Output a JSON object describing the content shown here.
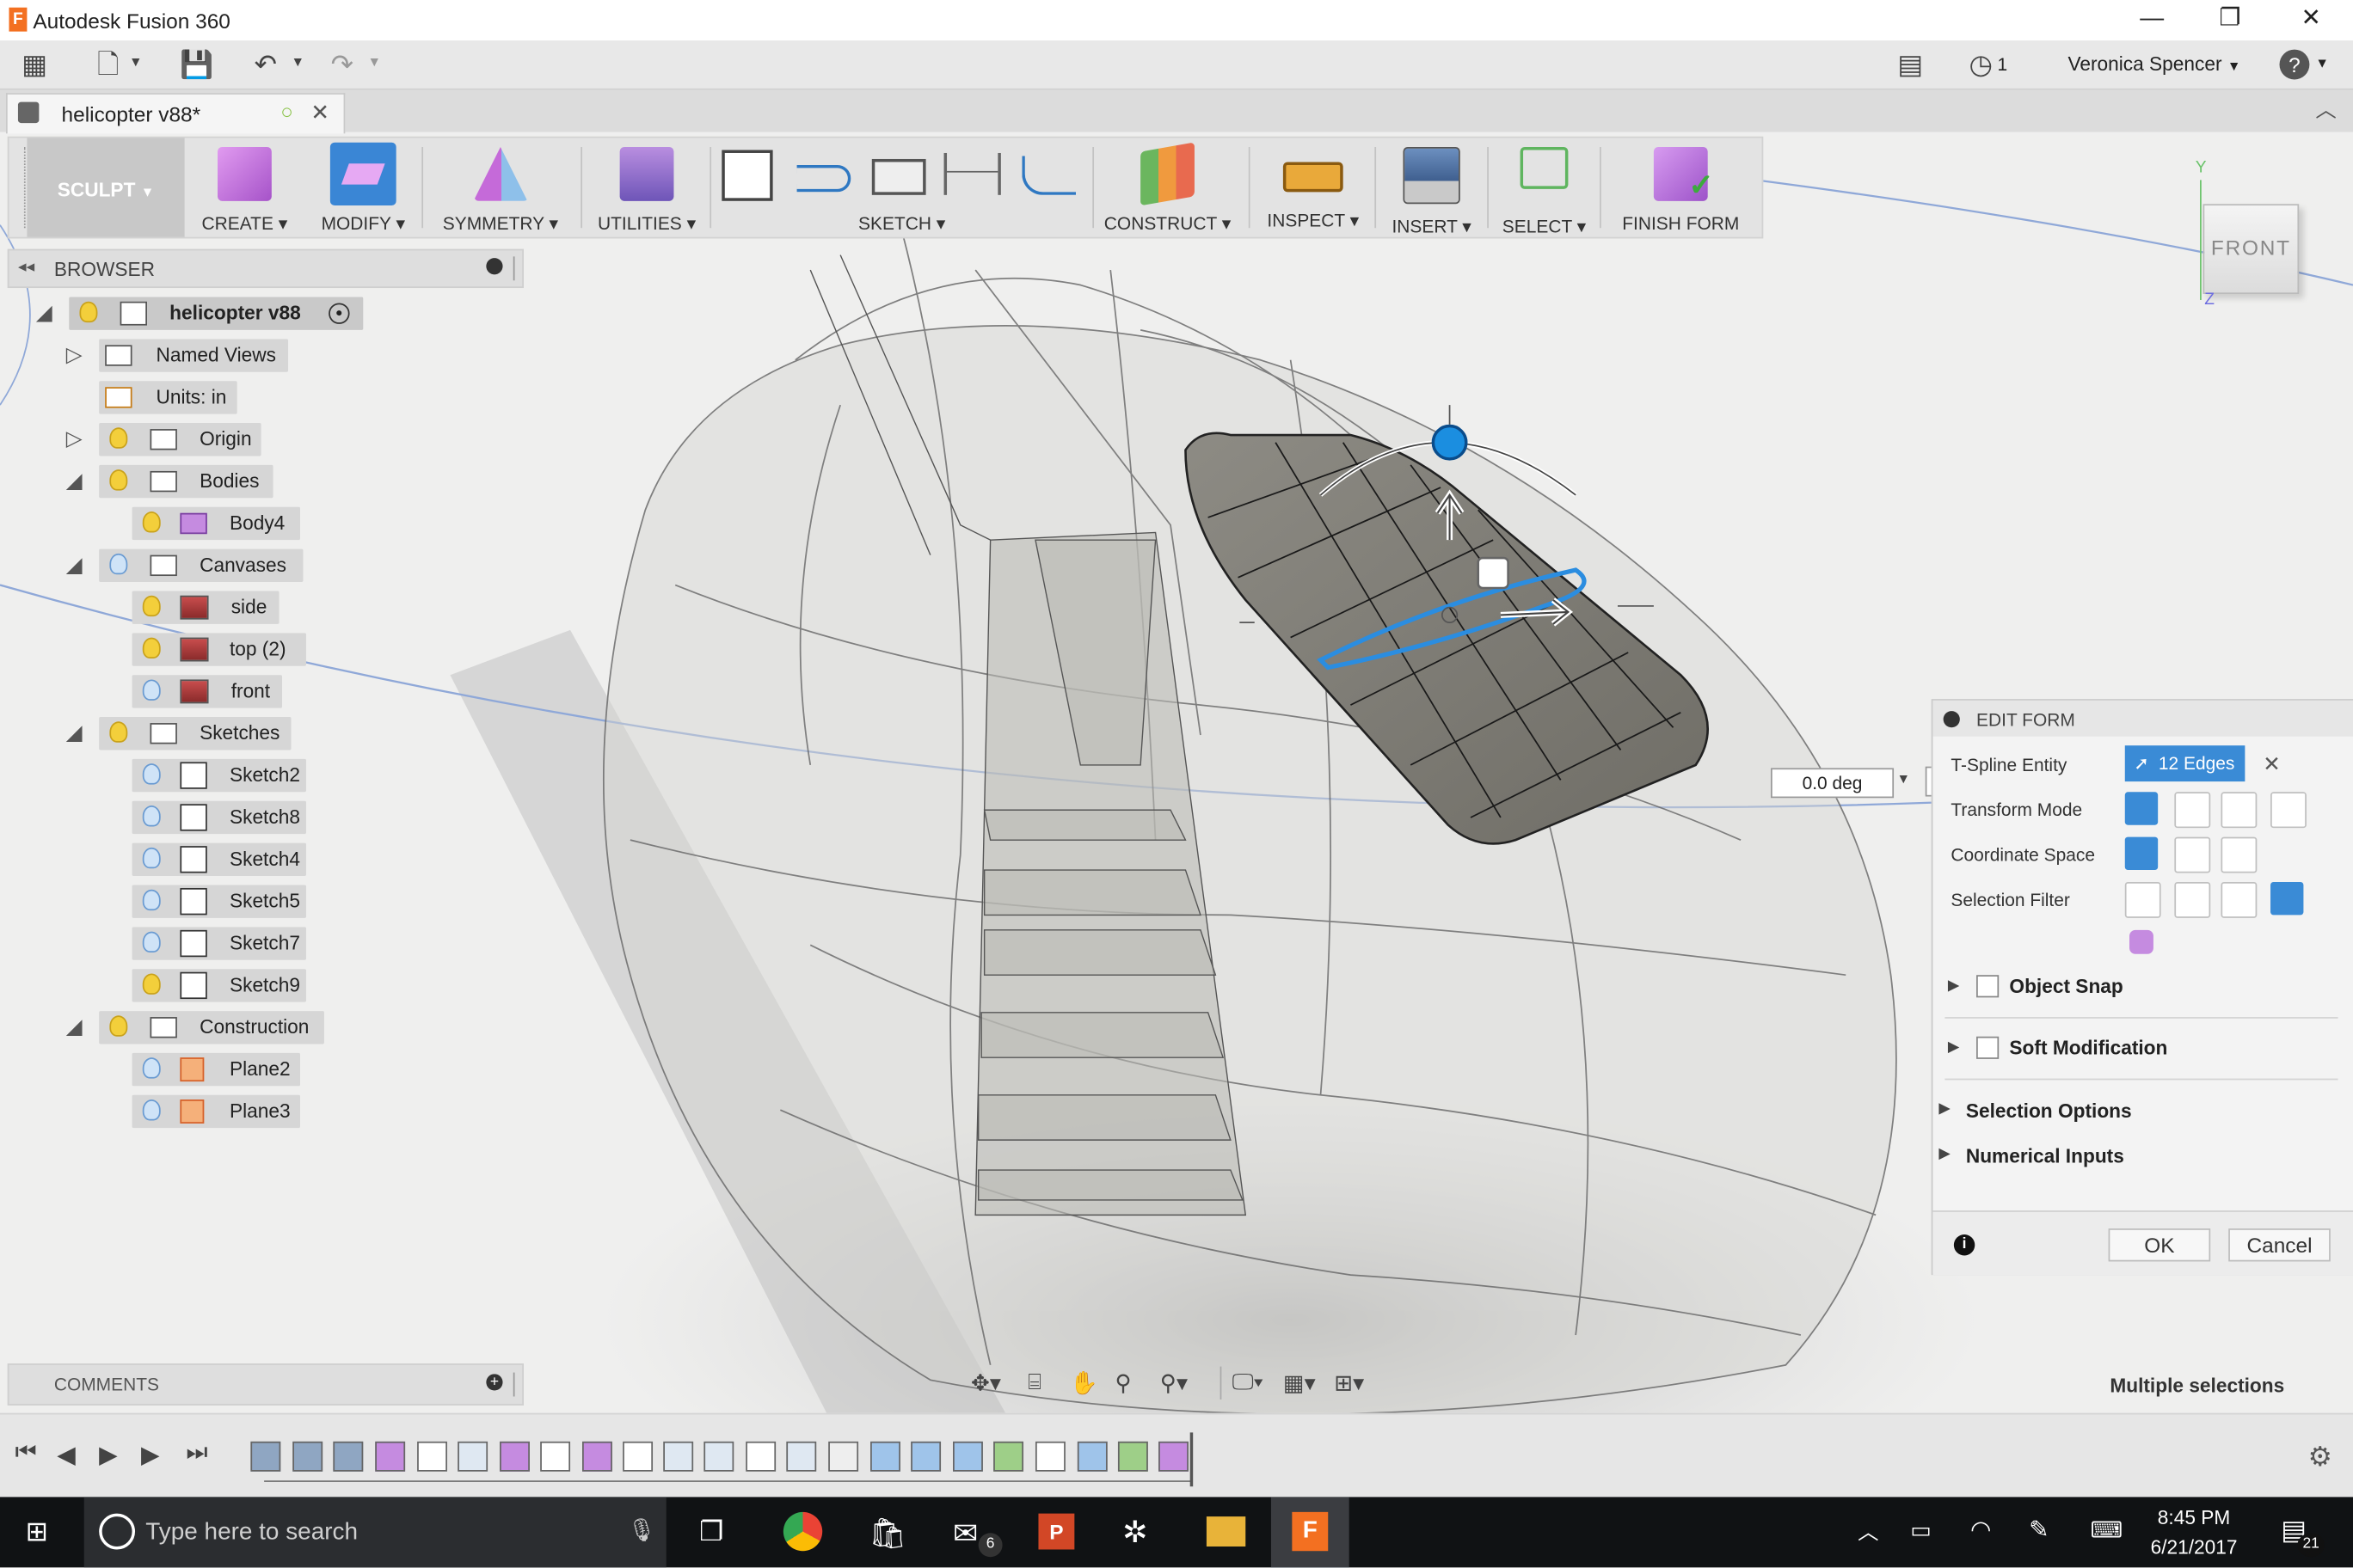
{
  "app": {
    "title": "Autodesk Fusion 360"
  },
  "quick_access": {
    "notifications": "1",
    "user": "Veronica Spencer"
  },
  "document_tab": {
    "name": "helicopter v88*"
  },
  "toolbar": {
    "workspace": "SCULPT",
    "groups": [
      "CREATE",
      "MODIFY",
      "SYMMETRY",
      "UTILITIES",
      "SKETCH",
      "CONSTRUCT",
      "INSPECT",
      "INSERT",
      "SELECT",
      "FINISH FORM"
    ]
  },
  "browser": {
    "title": "BROWSER",
    "root": "helicopter v88",
    "nodes": {
      "named_views": "Named Views",
      "units": "Units: in",
      "origin": "Origin",
      "bodies": "Bodies",
      "body4": "Body4",
      "canvases": "Canvases",
      "side": "side",
      "top": "top (2)",
      "front": "front",
      "sketches": "Sketches",
      "sketch2": "Sketch2",
      "sketch8": "Sketch8",
      "sketch4": "Sketch4",
      "sketch5": "Sketch5",
      "sketch7": "Sketch7",
      "sketch9": "Sketch9",
      "construction": "Construction",
      "plane2": "Plane2",
      "plane3": "Plane3"
    }
  },
  "viewcube": {
    "face": "FRONT",
    "axis_y": "Y",
    "axis_z": "Z"
  },
  "rotation_input": {
    "value": "0.0 deg"
  },
  "edit_form": {
    "title": "EDIT FORM",
    "tspline_label": "T-Spline Entity",
    "selection_value": "12 Edges",
    "transform_mode_label": "Transform Mode",
    "coordinate_space_label": "Coordinate Space",
    "selection_filter_label": "Selection Filter",
    "object_snap": "Object Snap",
    "soft_modification": "Soft Modification",
    "selection_options": "Selection Options",
    "numerical_inputs": "Numerical Inputs",
    "ok": "OK",
    "cancel": "Cancel"
  },
  "comments": {
    "title": "COMMENTS"
  },
  "status": {
    "text": "Multiple selections"
  },
  "taskbar": {
    "search_placeholder": "Type here to search",
    "mail_badge": "6",
    "time": "8:45 PM",
    "date": "6/21/2017",
    "notif_badge": "21"
  }
}
